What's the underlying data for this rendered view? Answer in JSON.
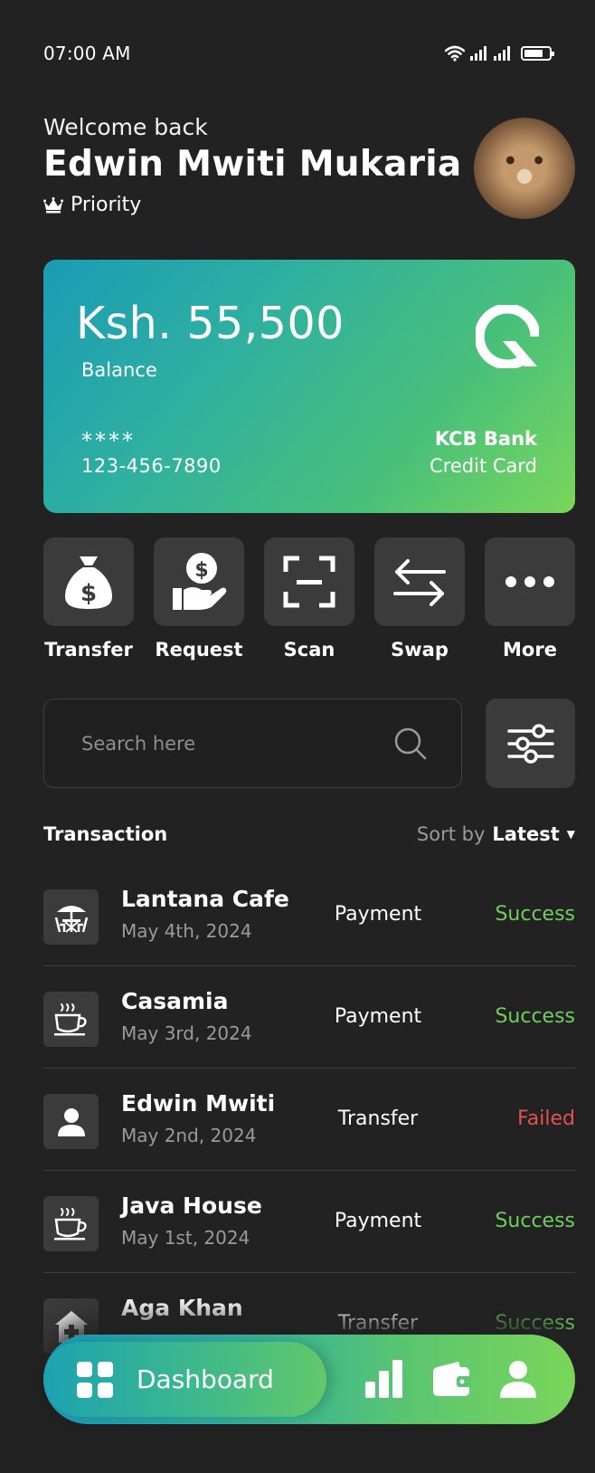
{
  "status_bar": {
    "time": "07:00 AM"
  },
  "header": {
    "welcome": "Welcome back",
    "user_name": "Edwin Mwiti Mukaria",
    "tier": "Priority"
  },
  "card": {
    "balance": "Ksh. 55,500",
    "balance_label": "Balance",
    "masked": "****",
    "number": "123-456-7890",
    "bank": "KCB Bank",
    "type": "Credit Card"
  },
  "actions": [
    {
      "label": "Transfer",
      "icon": "money-bag-icon"
    },
    {
      "label": "Request",
      "icon": "hand-coin-icon"
    },
    {
      "label": "Scan",
      "icon": "scan-icon"
    },
    {
      "label": "Swap",
      "icon": "swap-arrows-icon"
    },
    {
      "label": "More",
      "icon": "more-dots-icon"
    }
  ],
  "search": {
    "placeholder": "Search here"
  },
  "transactions": {
    "title": "Transaction",
    "sort_label": "Sort by",
    "sort_value": "Latest",
    "items": [
      {
        "name": "Lantana Cafe",
        "date": "May 4th, 2024",
        "type": "Payment",
        "status": "Success",
        "icon": "cafe-table-icon"
      },
      {
        "name": "Casamia",
        "date": "May 3rd, 2024",
        "type": "Payment",
        "status": "Success",
        "icon": "coffee-cup-icon"
      },
      {
        "name": "Edwin Mwiti",
        "date": "May 2nd, 2024",
        "type": "Transfer",
        "status": "Failed",
        "icon": "person-icon"
      },
      {
        "name": "Java House",
        "date": "May 1st, 2024",
        "type": "Payment",
        "status": "Success",
        "icon": "coffee-cup-icon"
      },
      {
        "name": "Aga Khan",
        "date": "",
        "type": "Transfer",
        "status": "Success",
        "icon": "hospital-icon"
      }
    ]
  },
  "nav": {
    "active_label": "Dashboard",
    "items": [
      "dashboard-grid-icon",
      "bar-chart-icon",
      "wallet-icon",
      "profile-icon"
    ]
  },
  "colors": {
    "background": "#222222",
    "tile": "#3b3b3b",
    "success": "#6dce5e",
    "failed": "#e0534f",
    "accent_start": "#1b9bb5",
    "accent_end": "#7ad65a"
  }
}
